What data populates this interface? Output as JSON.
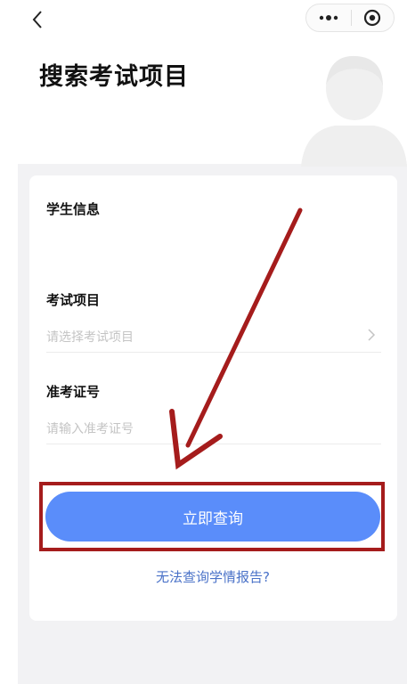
{
  "nav": {
    "back_icon": "chevron-left-icon",
    "more_icon": "more-dots-icon",
    "close_icon": "target-circle-icon"
  },
  "page": {
    "title": "搜索考试项目"
  },
  "form": {
    "student_info_label": "学生信息",
    "exam_item_label": "考试项目",
    "exam_item_placeholder": "请选择考试项目",
    "ticket_number_label": "准考证号",
    "ticket_number_placeholder": "请输入准考证号",
    "submit_label": "立即查询",
    "help_link": "无法查询学情报告?"
  },
  "colors": {
    "primary_button": "#5a8dfa",
    "annotation_red": "#a51c1c",
    "link_blue": "#4a72c8",
    "panel_gray": "#f2f2f4"
  }
}
